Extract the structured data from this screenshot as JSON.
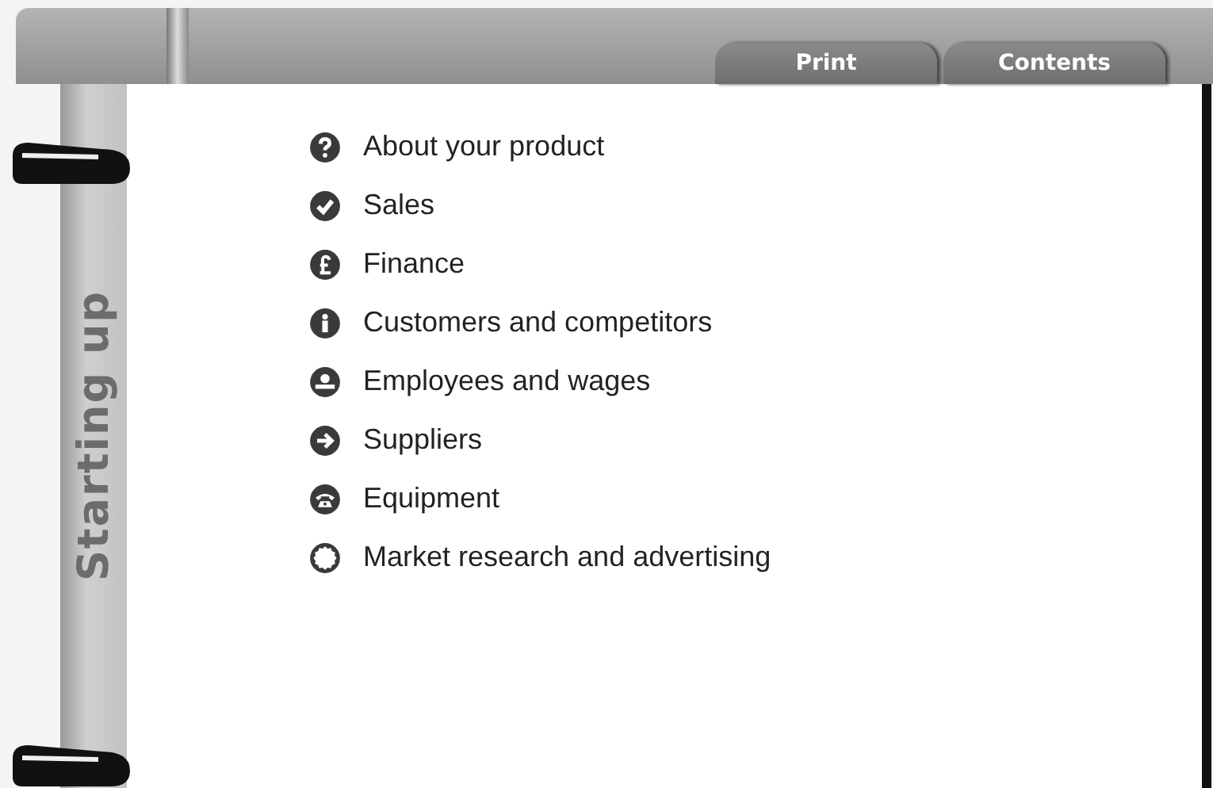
{
  "tabs": [
    {
      "label": "Print"
    },
    {
      "label": "Contents"
    }
  ],
  "spine": {
    "title": "Starting up"
  },
  "items": [
    {
      "kind": "question",
      "label": "About your product"
    },
    {
      "kind": "check",
      "label": "Sales"
    },
    {
      "kind": "pound",
      "label": "Finance"
    },
    {
      "kind": "info",
      "label": "Customers and competitors"
    },
    {
      "kind": "person",
      "label": "Employees and wages"
    },
    {
      "kind": "arrow",
      "label": "Suppliers"
    },
    {
      "kind": "phone",
      "label": "Equipment"
    },
    {
      "kind": "burst",
      "label": "Market research and advertising"
    }
  ]
}
